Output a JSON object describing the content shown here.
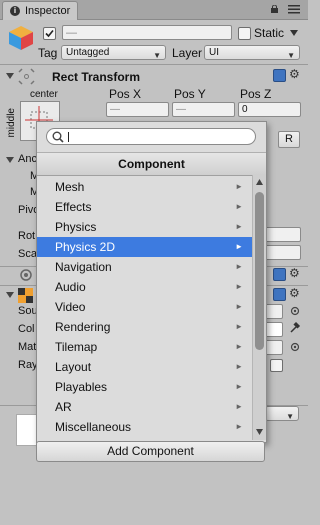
{
  "tab": {
    "label": "Inspector"
  },
  "header": {
    "name_value": "—",
    "static_label": "Static",
    "tag_label": "Tag",
    "tag_value": "Untagged",
    "layer_label": "Layer",
    "layer_value": "UI"
  },
  "rect_transform": {
    "title": "Rect Transform",
    "anchor_h": "center",
    "anchor_v": "middle",
    "pos_x_label": "Pos X",
    "pos_y_label": "Pos Y",
    "pos_z_label": "Pos Z",
    "pos_x_value": "—",
    "pos_y_value": "—",
    "pos_z_value": "0",
    "r_button": "R"
  },
  "left_partial_labels": [
    "Anc",
    "M",
    "M",
    "Pivo",
    "Rot",
    "Sca",
    "Sou",
    "Col",
    "Mat",
    "Ray"
  ],
  "popup": {
    "title": "Component",
    "search_value": "",
    "items": [
      {
        "label": "Mesh"
      },
      {
        "label": "Effects"
      },
      {
        "label": "Physics"
      },
      {
        "label": "Physics 2D"
      },
      {
        "label": "Navigation"
      },
      {
        "label": "Audio"
      },
      {
        "label": "Video"
      },
      {
        "label": "Rendering"
      },
      {
        "label": "Tilemap"
      },
      {
        "label": "Layout"
      },
      {
        "label": "Playables"
      },
      {
        "label": "AR"
      },
      {
        "label": "Miscellaneous"
      }
    ],
    "selected_index": 3,
    "arrow_glyph": "►"
  },
  "add_component_label": "Add Component",
  "colors": {
    "selection": "#3d7be0",
    "background": "#c2c2c2"
  }
}
